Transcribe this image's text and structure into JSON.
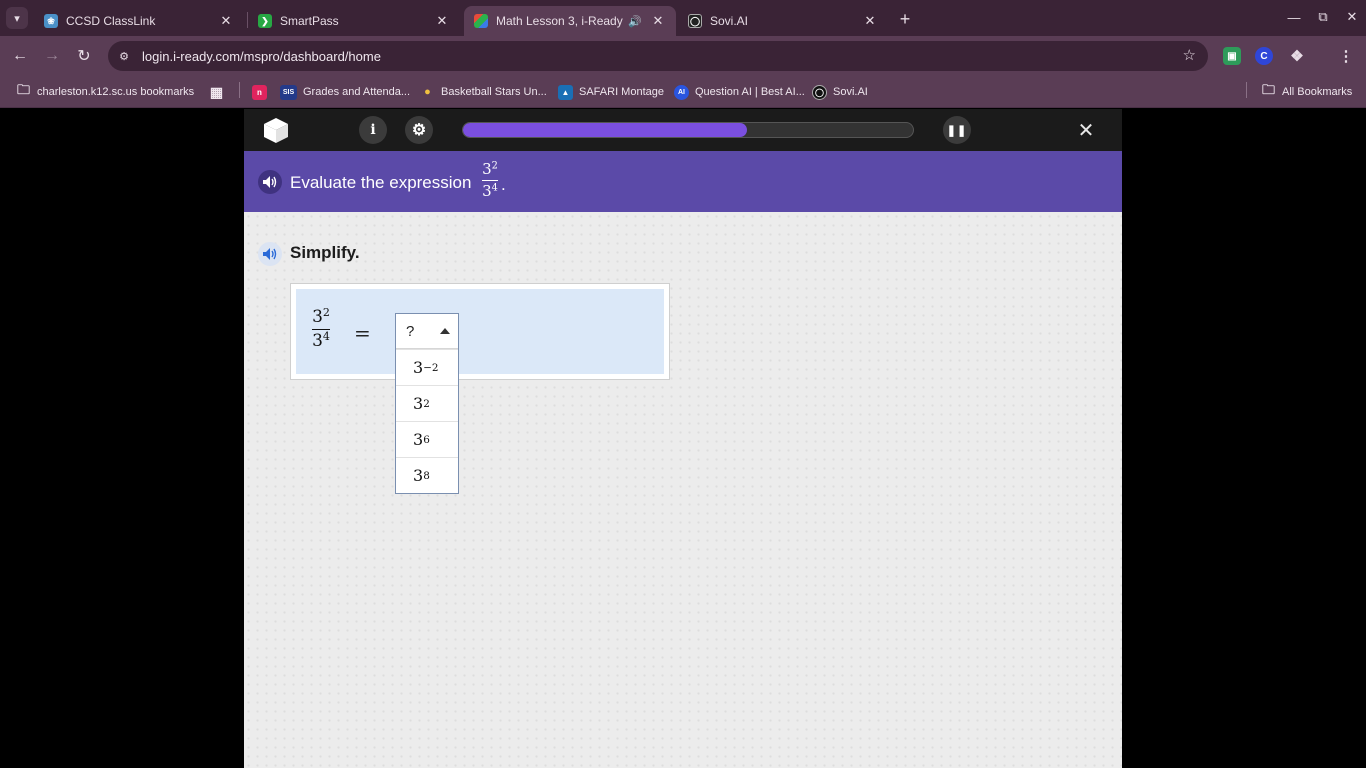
{
  "browser": {
    "tabs": [
      {
        "title": "CCSD ClassLink",
        "favicon": "classlink-icon",
        "color": "#4a90c8",
        "active": false
      },
      {
        "title": "SmartPass",
        "favicon": "smartpass-icon",
        "color": "#27a844",
        "active": false
      },
      {
        "title": "Math Lesson 3, i-Ready",
        "favicon": "iready-icon",
        "color": "#e8a33a",
        "active": true
      },
      {
        "title": "Sovi.AI",
        "favicon": "sovi-icon",
        "color": "#222222",
        "active": false
      }
    ],
    "url": "login.i-ready.com/mspro/dashboard/home",
    "bookmarks": [
      {
        "label": "charleston.k12.sc.us bookmarks"
      },
      {
        "label": "Grades and Attenda..."
      },
      {
        "label": "Basketball Stars Un..."
      },
      {
        "label": "SAFARI Montage"
      },
      {
        "label": "Question AI | Best AI..."
      },
      {
        "label": "Sovi.AI"
      }
    ],
    "all_bookmarks": "All Bookmarks",
    "bookmark_badges": {
      "sis": "SIS",
      "ai": "AI",
      "n": "n",
      "c": "C"
    }
  },
  "lesson": {
    "progress_fraction": 0.63,
    "accent_color": "#7b4fe0",
    "prompt": {
      "text": "Evaluate the expression",
      "base": "3",
      "num_exp": "2",
      "den_exp": "4",
      "end": "."
    },
    "instruction": "Simplify.",
    "equation": {
      "base": "3",
      "num_exp": "2",
      "den_exp": "4",
      "equals": "="
    },
    "dropdown": {
      "selected": "?",
      "options": [
        {
          "base": "3",
          "exp": "−2"
        },
        {
          "base": "3",
          "exp": "2"
        },
        {
          "base": "3",
          "exp": "6"
        },
        {
          "base": "3",
          "exp": "8"
        }
      ]
    }
  }
}
